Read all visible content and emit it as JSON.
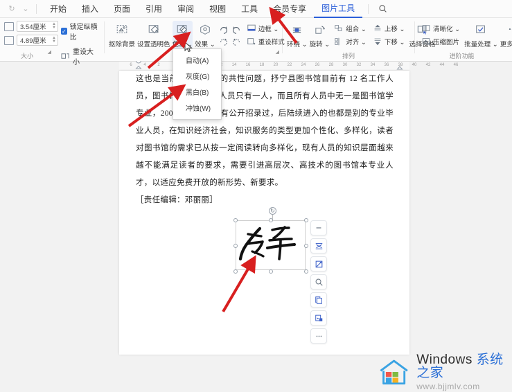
{
  "menubar": {
    "quick_access": [
      {
        "name": "refresh-icon",
        "glyph": "↻"
      },
      {
        "name": "chevron-down-icon",
        "glyph": "⌄"
      }
    ],
    "items": [
      {
        "label": "开始",
        "active": false
      },
      {
        "label": "插入",
        "active": false
      },
      {
        "label": "页面",
        "active": false
      },
      {
        "label": "引用",
        "active": false
      },
      {
        "label": "审阅",
        "active": false
      },
      {
        "label": "视图",
        "active": false
      },
      {
        "label": "工具",
        "active": false
      },
      {
        "label": "会员专享",
        "active": false
      },
      {
        "label": "图片工具",
        "active": true
      }
    ],
    "search_icon": "search-icon"
  },
  "ribbon": {
    "groups": [
      {
        "name": "size",
        "label": "大小",
        "height_value": "3.54厘米",
        "width_value": "4.89厘米",
        "lock_aspect_label": "锁定纵横比",
        "lock_aspect_checked": true,
        "reset_size_label": "重设大小"
      },
      {
        "name": "adjust",
        "label": "",
        "buttons": [
          {
            "label": "抠除背景",
            "icon": "remove-background-icon",
            "dropdown": true
          },
          {
            "label": "设置透明色",
            "icon": "set-transparent-color-icon",
            "dropdown": false
          },
          {
            "label": "色彩",
            "icon": "color-icon",
            "dropdown": true,
            "highlighted": true
          },
          {
            "label": "效果",
            "icon": "effects-icon",
            "dropdown": true
          }
        ],
        "small_buttons": [
          {
            "label": "边框",
            "icon": "border-icon",
            "dropdown": true
          },
          {
            "label": "重设样式",
            "icon": "reset-style-icon",
            "dropdown": false
          }
        ],
        "rotate_icons": [
          "rotate-right-icon",
          "rotate-left-icon",
          "flip-vertical-icon",
          "flip-horizontal-icon"
        ]
      },
      {
        "name": "arrange",
        "label": "排列",
        "buttons": [
          {
            "label": "环绕",
            "icon": "text-wrap-icon",
            "dropdown": true
          },
          {
            "label": "旋转",
            "icon": "rotate-icon",
            "dropdown": true
          },
          {
            "label": "选择窗格",
            "icon": "selection-pane-icon",
            "dropdown": false
          }
        ],
        "small_buttons": [
          {
            "label": "组合",
            "icon": "group-icon",
            "dropdown": true
          },
          {
            "label": "对齐",
            "icon": "align-icon",
            "dropdown": true
          },
          {
            "label": "上移",
            "icon": "bring-forward-icon",
            "dropdown": true
          },
          {
            "label": "下移",
            "icon": "send-backward-icon",
            "dropdown": true
          }
        ]
      },
      {
        "name": "advanced",
        "label": "进阶功能",
        "small_buttons": [
          {
            "label": "清晰化",
            "icon": "sharpen-icon",
            "dropdown": true
          },
          {
            "label": "压缩图片",
            "icon": "compress-image-icon",
            "dropdown": false
          }
        ],
        "buttons": [
          {
            "label": "批量处理",
            "icon": "batch-process-icon",
            "dropdown": true
          },
          {
            "label": "更多工...",
            "icon": "more-tools-icon",
            "dropdown": false
          }
        ]
      }
    ]
  },
  "color_dropdown": {
    "name": "color-menu",
    "items": [
      {
        "label": "自动(A)",
        "checked": false
      },
      {
        "label": "灰度(G)",
        "checked": false
      },
      {
        "label": "黑白(B)",
        "checked": true
      },
      {
        "label": "冲蚀(W)",
        "checked": false
      }
    ],
    "check_glyph": "✓"
  },
  "ruler": {
    "ticks_left": [
      "6",
      "4",
      "2"
    ],
    "ticks_right": [
      "12",
      "14",
      "16",
      "18",
      "20",
      "22",
      "24",
      "26",
      "28",
      "30",
      "32",
      "34",
      "36",
      "38",
      "40",
      "42",
      "44",
      "46"
    ]
  },
  "document": {
    "paragraphs": [
      "这也是当前基层图书馆的共性问题，抒宁县图书馆目前有 12 名工作人员，图书馆学专业毕业人员只有一人，而且所有人员中无一是图书馆学专业，2000 年以来，没有公开招录过，后陆续进入的也都是别的专业毕业人员，在知识经济社会，知识服务的类型更加个性化、多样化，读者对图书馆的需求已从按一定阅读转向多样化，现有人员的知识层面越来越不能满足读者的要求，需要引进高层次、高技术的图书馆本专业人才，以适应免费开放的新形势、新要求。"
    ],
    "editor_line": "［责任编辑：邓丽丽］"
  },
  "selected_image": {
    "name": "signature-image",
    "alt": "手写签名图片",
    "rotate_handle": "rotate-handle"
  },
  "floating_toolbar": {
    "buttons": [
      {
        "name": "minimize-icon",
        "label": "—"
      },
      {
        "name": "wrap-text-icon",
        "label": ""
      },
      {
        "name": "crop-icon",
        "label": ""
      },
      {
        "name": "zoom-icon",
        "label": ""
      },
      {
        "name": "copy-icon",
        "label": ""
      },
      {
        "name": "save-as-picture-icon",
        "label": ""
      },
      {
        "name": "more-options-icon",
        "label": "⋯"
      }
    ]
  },
  "watermark": {
    "title_en": "Windows ",
    "title_cn": "系统之家",
    "url": "www.bjjmlv.com"
  }
}
